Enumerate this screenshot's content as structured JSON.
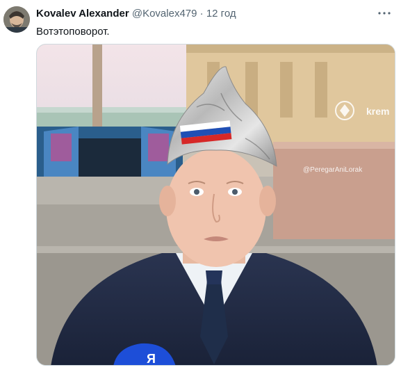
{
  "tweet": {
    "author_name": "Kovalev Alexander",
    "handle": "@Kovalex479",
    "separator": "·",
    "time": "12 год",
    "text": "Вотэтоповорот.",
    "more_icon": "more-horizontal-icon"
  },
  "media": {
    "watermark_brand": "krem",
    "watermark_credit": "@PeregarAniLorak",
    "mic_text": "Я"
  }
}
